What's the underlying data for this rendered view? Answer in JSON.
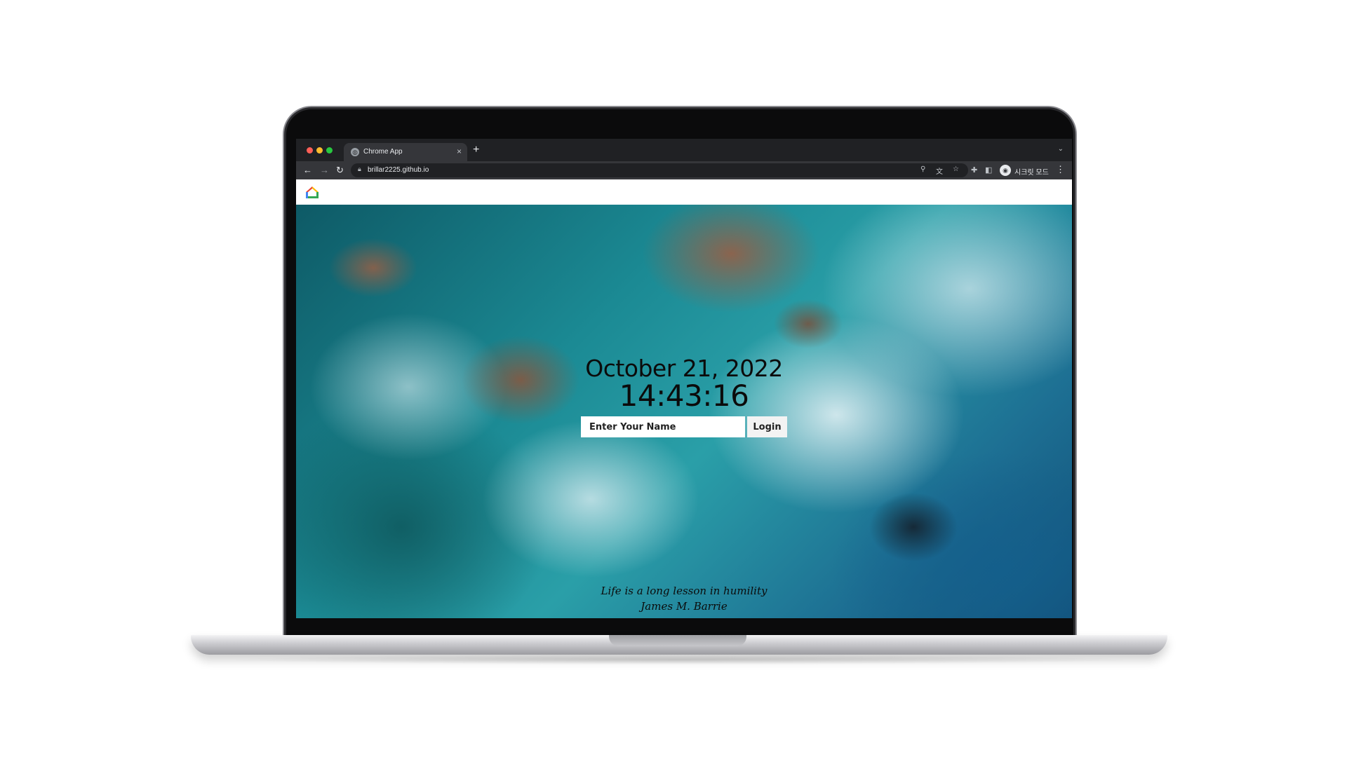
{
  "browser": {
    "tab": {
      "title": "Chrome App",
      "close": "×",
      "favicon": "globe-icon"
    },
    "new_tab": "+",
    "tab_list": "⌄",
    "url": "brillar2225.github.io",
    "profile_label": "시크릿 모드",
    "icons": [
      "back-arrow-icon",
      "forward-arrow-icon",
      "reload-icon",
      "lock-icon",
      "location-icon",
      "translate-icon",
      "star-icon",
      "extensions-icon",
      "side-panel-icon",
      "incognito-icon",
      "more-menu-icon"
    ]
  },
  "page": {
    "logo": "home-logo-icon",
    "date": "October 21, 2022",
    "time": "14:43:16",
    "login": {
      "placeholder": "Enter Your Name",
      "button": "Login"
    },
    "quote": {
      "text": "Life is a long lesson in humility",
      "author": "James M. Barrie"
    }
  },
  "colors": {
    "browser_dark": "#202124",
    "toolbar": "#35363a",
    "traffic_red": "#ff5f57",
    "traffic_yellow": "#febc2e",
    "traffic_green": "#28c840"
  }
}
